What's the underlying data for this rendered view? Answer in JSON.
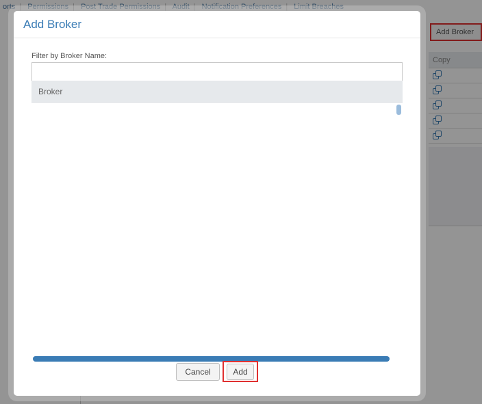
{
  "background": {
    "tabs": [
      "orts",
      "Permissions",
      "Post Trade Permissions",
      "Audit",
      "Notification Preferences",
      "Limit Breaches"
    ],
    "add_broker_label": "Add Broker",
    "copy_column_header": "Copy",
    "copy_rows": [
      "copy-icon",
      "copy-icon",
      "copy-icon",
      "copy-icon",
      "copy-icon"
    ]
  },
  "modal": {
    "title": "Add Broker",
    "filter_label": "Filter by Broker Name:",
    "filter_value": "",
    "list_column_header": "Broker",
    "progress": 1.0,
    "cancel_label": "Cancel",
    "add_label": "Add",
    "accent_color": "#3a7cb5",
    "highlight_color": "#e03030"
  }
}
